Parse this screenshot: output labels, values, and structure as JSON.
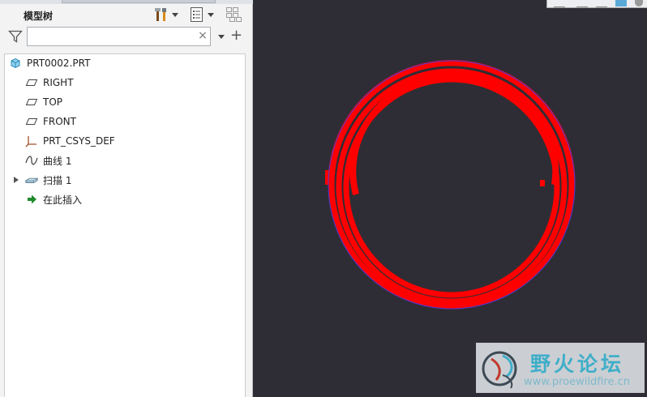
{
  "model_tree": {
    "title": "模型树",
    "search": {
      "value": "",
      "placeholder": ""
    },
    "items": [
      {
        "label": "PRT0002.PRT",
        "icon": "part-icon"
      },
      {
        "label": "RIGHT",
        "icon": "datum-plane-icon"
      },
      {
        "label": "TOP",
        "icon": "datum-plane-icon"
      },
      {
        "label": "FRONT",
        "icon": "datum-plane-icon"
      },
      {
        "label": "PRT_CSYS_DEF",
        "icon": "coordinate-system-icon"
      },
      {
        "label": "曲线 1",
        "icon": "curve-icon"
      },
      {
        "label": "扫描 1",
        "icon": "sweep-icon",
        "expandable": true
      },
      {
        "label": "在此插入",
        "icon": "insert-here-icon"
      }
    ]
  },
  "viewport": {
    "background": "#2e2d35",
    "geometry_color": "#ff0000"
  },
  "watermark": {
    "title": "野火论坛",
    "url": "www.proewildfire.cn"
  }
}
